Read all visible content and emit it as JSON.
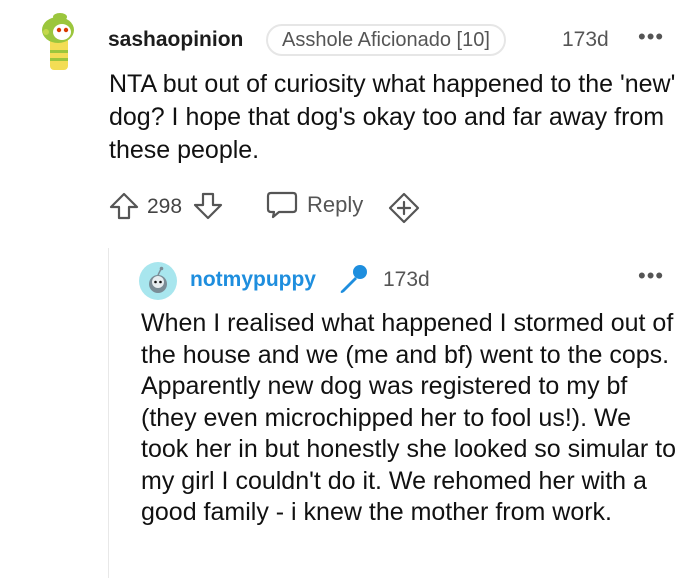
{
  "comment": {
    "author": "sashaopinion",
    "flair": "Asshole Aficionado [10]",
    "timestamp": "173d",
    "more": "•••",
    "body": "NTA but out of curiosity what happened to the 'new' dog? I hope that dog's okay too and far away from these people.",
    "score": "298",
    "reply_label": "Reply",
    "colors": {
      "flair_border": "#e6e6e6",
      "meta": "#555555"
    }
  },
  "reply": {
    "author": "notmypuppy",
    "timestamp": "173d",
    "more": "•••",
    "body": "When I realised what happened I stormed out of the house and we (me and bf) went to the cops. Apparently new dog was registered to my bf (they even microchipped her to fool us!). We took her in but honestly she looked so simular to my girl I couldn't do it. We rehomed her with a good family - i knew the mother from work.",
    "colors": {
      "author": "#1e8ede",
      "mic": "#1e8ede"
    }
  },
  "icons": [
    "snoo-avatar-icon",
    "upvote-arrow-icon",
    "downvote-arrow-icon",
    "reply-bubble-icon",
    "add-award-icon",
    "microphone-icon"
  ]
}
